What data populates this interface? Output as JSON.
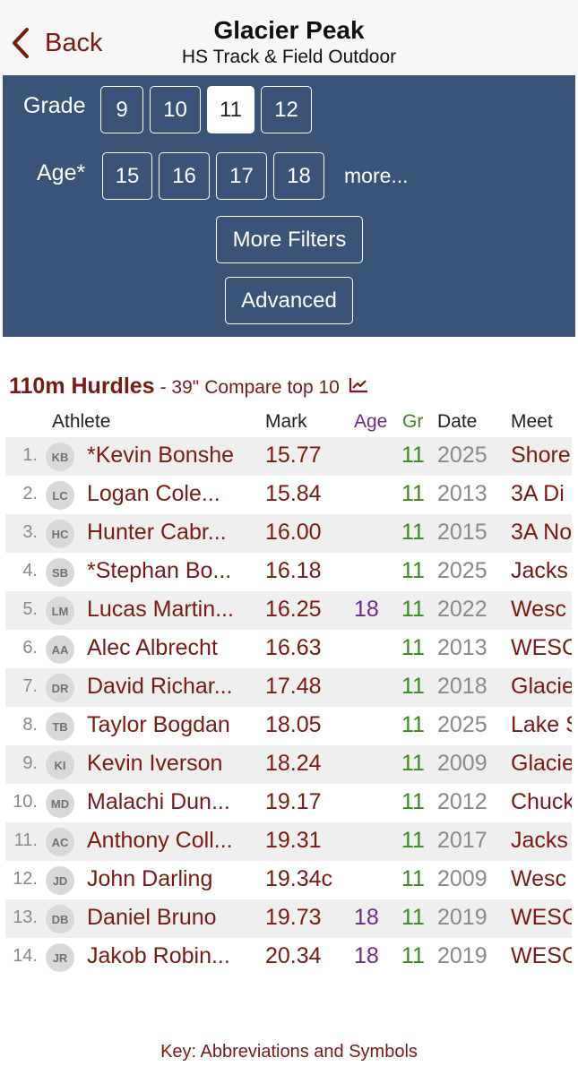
{
  "header": {
    "back_label": "Back",
    "title": "Glacier Peak",
    "subtitle": "HS Track & Field Outdoor"
  },
  "filters": {
    "grade_label": "Grade",
    "grades": [
      "9",
      "10",
      "11",
      "12"
    ],
    "selected_grade": "11",
    "age_label": "Age*",
    "ages": [
      "15",
      "16",
      "17",
      "18"
    ],
    "more_label": "more...",
    "more_filters_label": "More Filters",
    "advanced_label": "Advanced"
  },
  "event": {
    "name": "110m Hurdles",
    "detail": "- 39\"",
    "compare_label": "Compare top 10",
    "compare_icon": "chart-icon"
  },
  "columns": {
    "athlete": "Athlete",
    "mark": "Mark",
    "age": "Age",
    "gr": "Gr",
    "date": "Date",
    "meet": "Meet"
  },
  "rows": [
    {
      "rank": "1.",
      "initials": "KB",
      "name": "*Kevin Bonshe",
      "mark": "15.77",
      "age": "",
      "gr": "11",
      "date": "2025",
      "meet": "Shore"
    },
    {
      "rank": "2.",
      "initials": "LC",
      "name": "Logan Cole...",
      "mark": "15.84",
      "age": "",
      "gr": "11",
      "date": "2013",
      "meet": "3A Di"
    },
    {
      "rank": "3.",
      "initials": "HC",
      "name": "Hunter Cabr...",
      "mark": "16.00",
      "age": "",
      "gr": "11",
      "date": "2015",
      "meet": "3A No"
    },
    {
      "rank": "4.",
      "initials": "SB",
      "name": "*Stephan Bo...",
      "mark": "16.18",
      "age": "",
      "gr": "11",
      "date": "2025",
      "meet": "Jacks"
    },
    {
      "rank": "5.",
      "initials": "LM",
      "name": "Lucas Martin...",
      "mark": "16.25",
      "age": "18",
      "gr": "11",
      "date": "2022",
      "meet": "Wesc"
    },
    {
      "rank": "6.",
      "initials": "AA",
      "name": "Alec Albrecht",
      "mark": "16.63",
      "age": "",
      "gr": "11",
      "date": "2013",
      "meet": "WESC"
    },
    {
      "rank": "7.",
      "initials": "DR",
      "name": "David Richar...",
      "mark": "17.48",
      "age": "",
      "gr": "11",
      "date": "2018",
      "meet": "Glacie"
    },
    {
      "rank": "8.",
      "initials": "TB",
      "name": "Taylor Bogdan",
      "mark": "18.05",
      "age": "",
      "gr": "11",
      "date": "2025",
      "meet": "Lake S"
    },
    {
      "rank": "9.",
      "initials": "KI",
      "name": "Kevin Iverson",
      "mark": "18.24",
      "age": "",
      "gr": "11",
      "date": "2009",
      "meet": "Glacie"
    },
    {
      "rank": "10.",
      "initials": "MD",
      "name": "Malachi Dun...",
      "mark": "19.17",
      "age": "",
      "gr": "11",
      "date": "2012",
      "meet": "Chuck"
    },
    {
      "rank": "11.",
      "initials": "AC",
      "name": "Anthony Coll...",
      "mark": "19.31",
      "age": "",
      "gr": "11",
      "date": "2017",
      "meet": "Jacks"
    },
    {
      "rank": "12.",
      "initials": "JD",
      "name": "John Darling",
      "mark": "19.34c",
      "age": "",
      "gr": "11",
      "date": "2009",
      "meet": "Wesc"
    },
    {
      "rank": "13.",
      "initials": "DB",
      "name": "Daniel Bruno",
      "mark": "19.73",
      "age": "18",
      "gr": "11",
      "date": "2019",
      "meet": "WESC"
    },
    {
      "rank": "14.",
      "initials": "JR",
      "name": "Jakob Robin...",
      "mark": "20.34",
      "age": "18",
      "gr": "11",
      "date": "2019",
      "meet": "WESC"
    }
  ],
  "footer": {
    "key_label": "Key: Abbreviations and Symbols"
  }
}
